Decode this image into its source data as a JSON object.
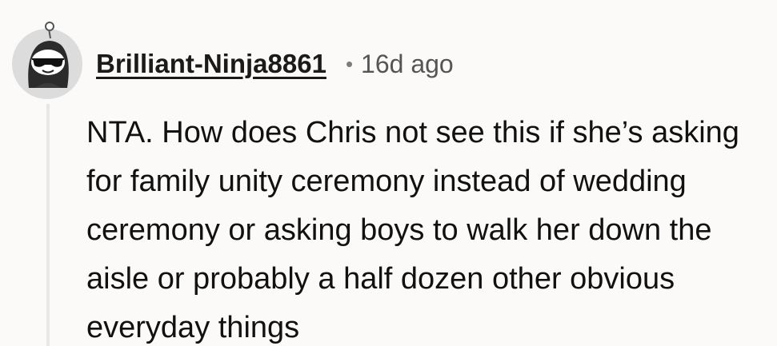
{
  "comment": {
    "author": "Brilliant-Ninja8861",
    "separator": "•",
    "age": "16d ago",
    "text": "NTA. How does Chris not see this if she’s asking for family unity ceremony instead of wedding ceremony or asking boys to walk her down the aisle or probably a half dozen other obvious everyday things",
    "avatar_icon": "snoo-avatar-sunglasses-icon"
  },
  "colors": {
    "background": "#fbfaf9",
    "text": "#111111",
    "muted": "#555555",
    "thread_line": "#e9e6e3"
  }
}
